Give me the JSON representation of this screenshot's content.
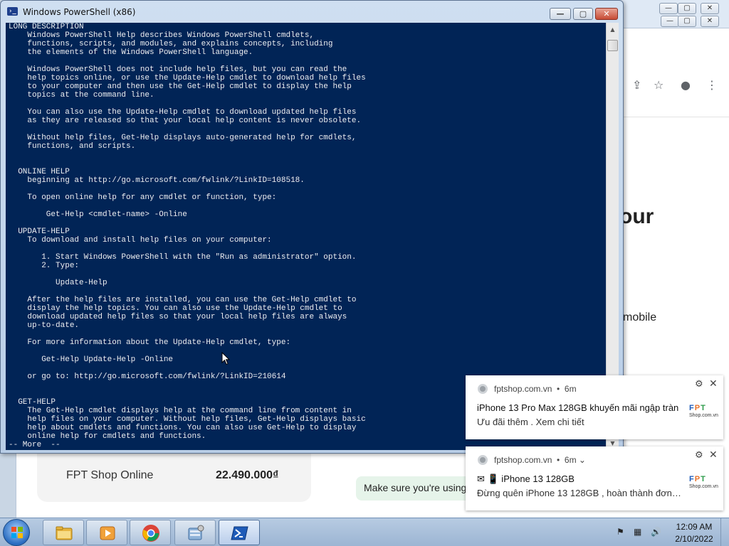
{
  "powershell": {
    "title": "Windows PowerShell (x86)",
    "controls": {
      "minimize": "—",
      "maximize": "▢",
      "close": "✕"
    },
    "console_text": "LONG DESCRIPTION\n    Windows PowerShell Help describes Windows PowerShell cmdlets,\n    functions, scripts, and modules, and explains concepts, including\n    the elements of the Windows PowerShell language.\n\n    Windows PowerShell does not include help files, but you can read the\n    help topics online, or use the Update-Help cmdlet to download help files\n    to your computer and then use the Get-Help cmdlet to display the help\n    topics at the command line.\n\n    You can also use the Update-Help cmdlet to download updated help files\n    as they are released so that your local help content is never obsolete.\n\n    Without help files, Get-Help displays auto-generated help for cmdlets,\n    functions, and scripts.\n\n\n  ONLINE HELP\n    beginning at http://go.microsoft.com/fwlink/?LinkID=108518.\n\n    To open online help for any cmdlet or function, type:\n\n        Get-Help <cmdlet-name> -Online\n\n  UPDATE-HELP\n    To download and install help files on your computer:\n\n       1. Start Windows PowerShell with the \"Run as administrator\" option.\n       2. Type:\n\n          Update-Help\n\n    After the help files are installed, you can use the Get-Help cmdlet to\n    display the help topics. You can also use the Update-Help cmdlet to\n    download updated help files so that your local help files are always\n    up-to-date.\n\n    For more information about the Update-Help cmdlet, type:\n\n       Get-Help Update-Help -Online\n\n    or go to: http://go.microsoft.com/fwlink/?LinkID=210614\n\n\n  GET-HELP\n    The Get-Help cmdlet displays help at the command line from content in\n    help files on your computer. Without help files, Get-Help displays basic\n    help about cmdlets and functions. You can also use Get-Help to display\n    online help for cmdlets and functions.\n-- More  --",
    "console_bg": "#012456",
    "console_fg": "#eeedf0"
  },
  "browser": {
    "heading_partial": "our",
    "text_partial": "mobile",
    "product_store": "FPT Shop Online",
    "product_price": "22.490.000₫",
    "hint": "Make sure you're using"
  },
  "notifications": [
    {
      "source": "fptshop.com.vn",
      "age": "6m",
      "title": "iPhone 13 Pro Max 128GB khuyến mãi ngập tràn",
      "body": "Ưu đãi thêm . Xem chi tiết"
    },
    {
      "source": "fptshop.com.vn",
      "age": "6m",
      "title": "✉ 📱 iPhone 13 128GB",
      "body": "Đừng quên iPhone 13 128GB , hoàn thành đơn…"
    }
  ],
  "taskbar": {
    "apps": [
      "file-explorer-icon",
      "media-player-icon",
      "chrome-icon",
      "control-panel-icon",
      "powershell-icon"
    ],
    "clock_time": "12:09 AM",
    "clock_date": "2/10/2022"
  },
  "colors": {
    "powershell_blue": "#012456",
    "fpt_blue": "#1d5bb9",
    "fpt_orange": "#e8722a",
    "fpt_green": "#2d9b4a"
  }
}
